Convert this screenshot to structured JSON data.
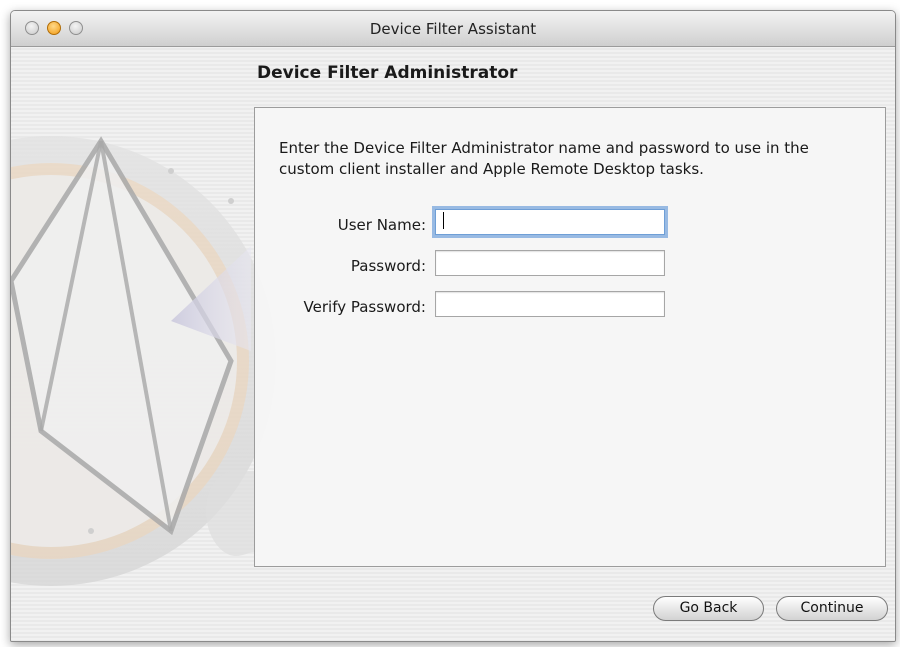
{
  "window": {
    "title": "Device Filter Assistant"
  },
  "page": {
    "heading": "Device Filter Administrator",
    "instructions": "Enter the Device Filter Administrator name and password to use in the custom client installer and Apple Remote Desktop tasks."
  },
  "form": {
    "user_name_label": "User Name:",
    "user_name_value": "",
    "password_label": "Password:",
    "password_value": "",
    "verify_password_label": "Verify Password:",
    "verify_password_value": ""
  },
  "buttons": {
    "go_back": "Go Back",
    "continue": "Continue"
  },
  "icons": {
    "watermark": "apple-remote-desktop-icon"
  },
  "colors": {
    "window_background": "#ededed",
    "focus_ring": "#78a5dc",
    "minimize_button": "#f29a12"
  }
}
